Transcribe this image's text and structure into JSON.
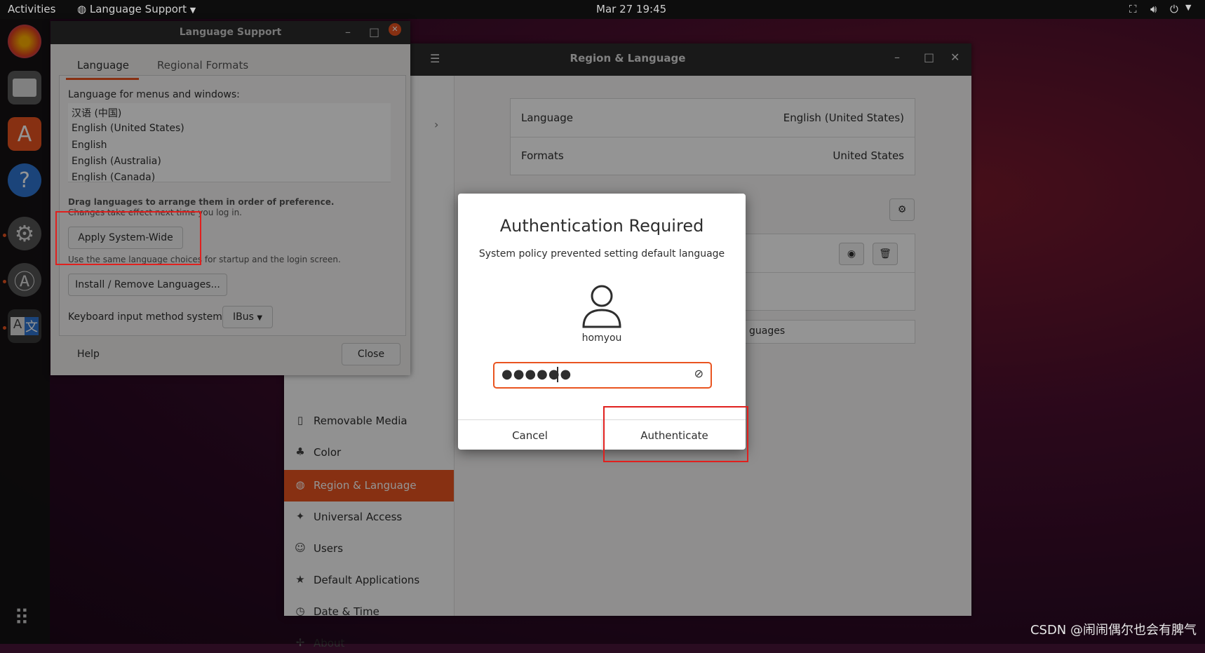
{
  "topbar": {
    "activities": "Activities",
    "app_menu": "Language Support",
    "clock": "Mar 27  19:45"
  },
  "dock": {
    "items": [
      "firefox-icon",
      "files-icon",
      "software-icon",
      "help-icon",
      "settings-icon",
      "updater-icon",
      "language-icon"
    ],
    "apps_grid": "apps-grid-icon"
  },
  "region_window": {
    "title": "Region & Language",
    "sidebar": [
      {
        "icon": "removable-media-icon",
        "label": "Removable Media"
      },
      {
        "icon": "color-icon",
        "label": "Color"
      },
      {
        "icon": "region-icon",
        "label": "Region & Language",
        "active": true
      },
      {
        "icon": "universal-access-icon",
        "label": "Universal Access"
      },
      {
        "icon": "users-icon",
        "label": "Users"
      },
      {
        "icon": "star-icon",
        "label": "Default Applications"
      },
      {
        "icon": "clock-icon",
        "label": "Date & Time"
      },
      {
        "icon": "about-icon",
        "label": "About"
      }
    ],
    "rows": [
      {
        "key": "Language",
        "value": "English (United States)"
      },
      {
        "key": "Formats",
        "value": "United States"
      }
    ],
    "manage_languages_fragment": "guages"
  },
  "lang_window": {
    "title": "Language Support",
    "tabs": [
      "Language",
      "Regional Formats"
    ],
    "menus_label": "Language for menus and windows:",
    "languages": [
      "汉语 (中国)",
      "English (United States)",
      "English",
      "English (Australia)",
      "English (Canada)"
    ],
    "drag_hint": "Drag languages to arrange them in order of preference.",
    "drag_hint2": "Changes take effect next time you log in.",
    "apply_btn": "Apply System-Wide",
    "apply_hint": "Use the same language choices for startup and the login screen.",
    "install_btn": "Install / Remove Languages...",
    "keyboard_label": "Keyboard input method system:",
    "keyboard_value": "IBus",
    "help": "Help",
    "close": "Close"
  },
  "auth": {
    "title": "Authentication Required",
    "message": "System policy prevented setting default language",
    "username": "homyou",
    "password_mask": "●●●●●●",
    "cancel": "Cancel",
    "authenticate": "Authenticate"
  },
  "watermark": "CSDN @闹闹偶尔也会有脾气",
  "colors": {
    "accent": "#e95420",
    "highlight": "#e0201e"
  }
}
